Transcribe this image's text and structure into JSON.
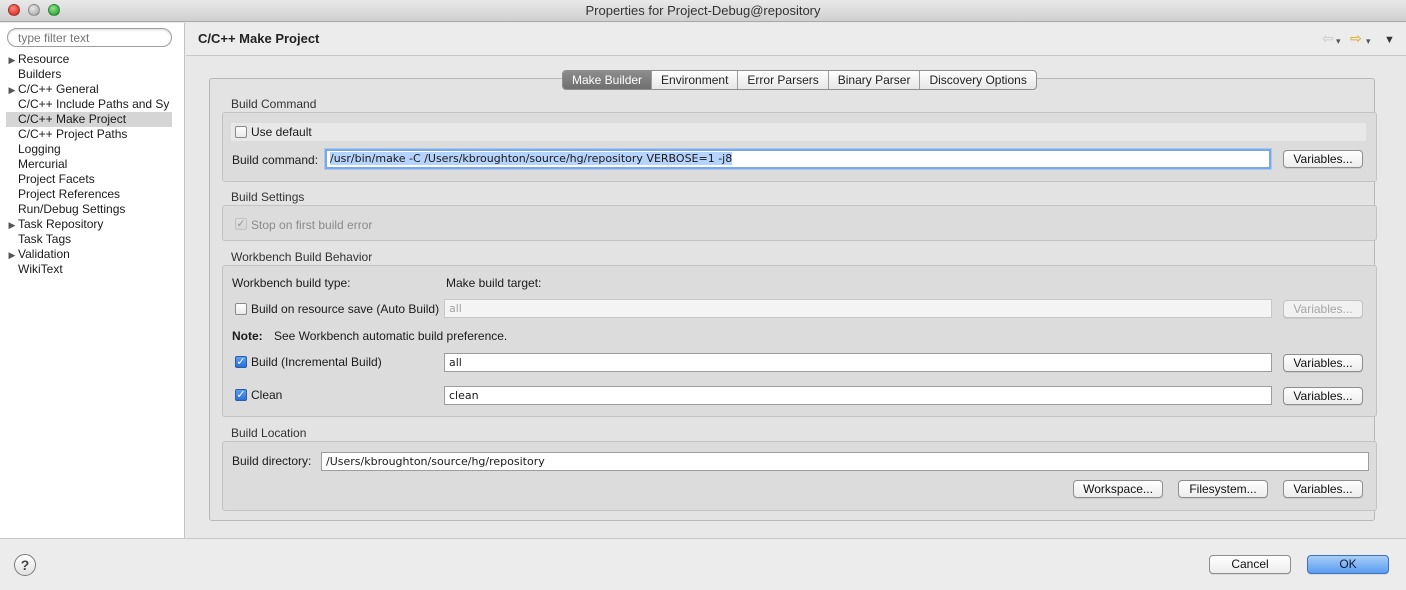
{
  "window": {
    "title": "Properties for Project-Debug@repository"
  },
  "sidebar": {
    "filter_placeholder": "type filter text",
    "items": [
      {
        "label": "Resource",
        "expandable": true
      },
      {
        "label": "Builders",
        "expandable": false
      },
      {
        "label": "C/C++ General",
        "expandable": true
      },
      {
        "label": "C/C++ Include Paths and Sy",
        "expandable": false
      },
      {
        "label": "C/C++ Make Project",
        "expandable": false,
        "selected": true
      },
      {
        "label": "C/C++ Project Paths",
        "expandable": false
      },
      {
        "label": "Logging",
        "expandable": false
      },
      {
        "label": "Mercurial",
        "expandable": false
      },
      {
        "label": "Project Facets",
        "expandable": false
      },
      {
        "label": "Project References",
        "expandable": false
      },
      {
        "label": "Run/Debug Settings",
        "expandable": false
      },
      {
        "label": "Task Repository",
        "expandable": true
      },
      {
        "label": "Task Tags",
        "expandable": false
      },
      {
        "label": "Validation",
        "expandable": true
      },
      {
        "label": "WikiText",
        "expandable": false
      }
    ],
    "expand_glyph": "▶"
  },
  "page": {
    "title": "C/C++ Make Project",
    "nav_back_glyph": "⇦",
    "nav_forward_glyph": "⇨",
    "menu_glyph": "▼",
    "dropdown_glyph": "▾"
  },
  "tabs": [
    {
      "label": "Make Builder",
      "active": true
    },
    {
      "label": "Environment",
      "active": false
    },
    {
      "label": "Error Parsers",
      "active": false
    },
    {
      "label": "Binary Parser",
      "active": false
    },
    {
      "label": "Discovery Options",
      "active": false
    }
  ],
  "build_command": {
    "group_label": "Build Command",
    "use_default_label": "Use default",
    "use_default_checked": false,
    "command_label": "Build command:",
    "command_value": "/usr/bin/make -C /Users/kbroughton/source/hg/repository VERBOSE=1 -j8",
    "variables_label": "Variables..."
  },
  "build_settings": {
    "group_label": "Build Settings",
    "stop_on_error_label": "Stop on first build error",
    "stop_on_error_checked": true
  },
  "workbench": {
    "group_label": "Workbench Build Behavior",
    "build_type_header": "Workbench build type:",
    "target_header": "Make build target:",
    "auto_build_label": "Build on resource save (Auto Build)",
    "auto_build_checked": false,
    "auto_build_target": "all",
    "note_label": "Note:",
    "note_text": "See Workbench automatic build preference.",
    "incremental_label": "Build (Incremental Build)",
    "incremental_checked": true,
    "incremental_target": "all",
    "clean_label": "Clean",
    "clean_checked": true,
    "clean_target": "clean",
    "variables_label": "Variables..."
  },
  "build_location": {
    "group_label": "Build Location",
    "directory_label": "Build directory:",
    "directory_value": "/Users/kbroughton/source/hg/repository",
    "workspace_label": "Workspace...",
    "filesystem_label": "Filesystem...",
    "variables_label": "Variables..."
  },
  "footer": {
    "help_glyph": "?",
    "cancel_label": "Cancel",
    "ok_label": "OK"
  },
  "check_glyph": "✓"
}
